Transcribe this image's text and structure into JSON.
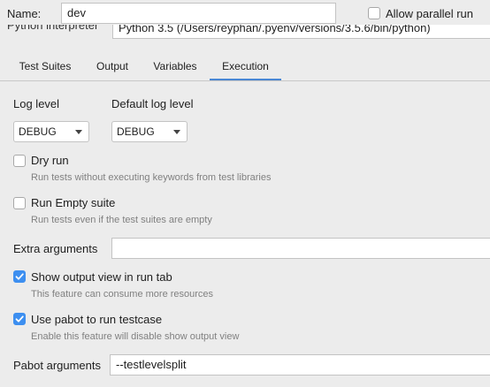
{
  "header": {
    "name_label": "Name:",
    "name_value": "dev",
    "allow_parallel_label": "Allow parallel run",
    "interpreter_label": "Python interpreter",
    "interpreter_value": "Python 3.5 (/Users/reyphan/.pyenv/versions/3.5.6/bin/python)"
  },
  "tabs": [
    {
      "label": "Test Suites"
    },
    {
      "label": "Output"
    },
    {
      "label": "Variables"
    },
    {
      "label": "Execution",
      "active": true
    }
  ],
  "execution": {
    "log_level_label": "Log level",
    "log_level_value": "DEBUG",
    "default_log_level_label": "Default log level",
    "default_log_level_value": "DEBUG",
    "dry_run": {
      "label": "Dry run",
      "desc": "Run tests without executing keywords from test libraries",
      "checked": false
    },
    "run_empty_suite": {
      "label": "Run Empty suite",
      "desc": "Run tests even if the test suites are empty",
      "checked": false
    },
    "extra_arguments_label": "Extra arguments",
    "extra_arguments_value": "",
    "show_output_view": {
      "label": "Show output view in run tab",
      "desc": "This feature can consume more resources",
      "checked": true
    },
    "use_pabot": {
      "label": "Use pabot to run testcase",
      "desc": "Enable this feature will disable show output view",
      "checked": true
    },
    "pabot_arguments_label": "Pabot arguments",
    "pabot_arguments_value": "--testlevelsplit"
  },
  "colors": {
    "accent": "#3d8ff0",
    "tab_underline": "#4a87d4"
  }
}
